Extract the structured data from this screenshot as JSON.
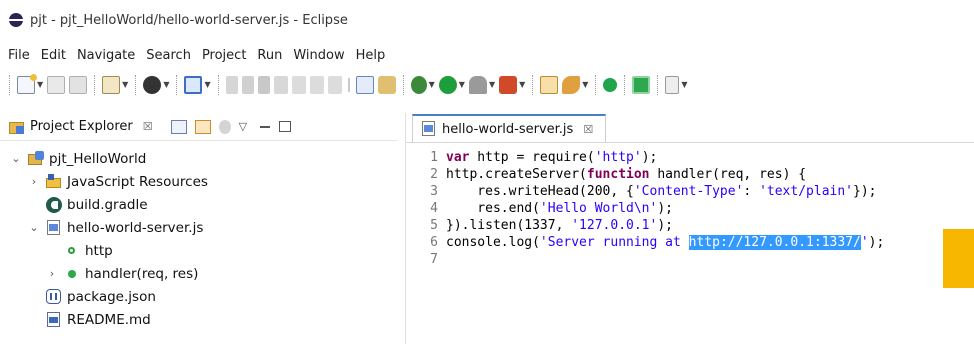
{
  "window": {
    "title": "pjt - pjt_HelloWorld/hello-world-server.js - Eclipse"
  },
  "menu": [
    "File",
    "Edit",
    "Navigate",
    "Search",
    "Project",
    "Run",
    "Window",
    "Help"
  ],
  "toolbar": {
    "icons": [
      "new-wizard-icon",
      "save-icon",
      "save-all-icon",
      "new-package-icon",
      "debug-icon",
      "open-perspective-icon",
      "skip-breakpoints-icon",
      "suspend-icon",
      "terminate-icon",
      "disconnect-icon",
      "step-into-icon",
      "step-over-icon",
      "step-return-icon",
      "format-icon",
      "run-last-icon",
      "run-icon",
      "coverage-icon",
      "external-tools-icon",
      "open-type-icon",
      "search-icon",
      "pin-icon",
      "next-annotation-icon"
    ]
  },
  "project_explorer": {
    "tab_label": "Project Explorer",
    "close_glyph": "☒",
    "tree": [
      {
        "label": "pjt_HelloWorld",
        "depth": 0,
        "twisty": "expanded",
        "icon": "project-icon"
      },
      {
        "label": "JavaScript Resources",
        "depth": 1,
        "twisty": "collapsed",
        "icon": "js-resources-icon"
      },
      {
        "label": "build.gradle",
        "depth": 1,
        "twisty": "none",
        "icon": "gradle-icon"
      },
      {
        "label": "hello-world-server.js",
        "depth": 1,
        "twisty": "expanded",
        "icon": "js-file-icon",
        "selected": true
      },
      {
        "label": "http",
        "depth": 2,
        "twisty": "none",
        "icon": "variable-icon"
      },
      {
        "label": "handler(req, res)",
        "depth": 2,
        "twisty": "collapsed",
        "icon": "function-icon"
      },
      {
        "label": "package.json",
        "depth": 1,
        "twisty": "none",
        "icon": "json-file-icon"
      },
      {
        "label": "README.md",
        "depth": 1,
        "twisty": "none",
        "icon": "md-file-icon"
      }
    ]
  },
  "editor": {
    "tab_label": "hello-world-server.js",
    "close_glyph": "☒",
    "lines": [
      {
        "n": "1",
        "parts": [
          {
            "t": "var",
            "c": "kw"
          },
          {
            "t": " http = require(",
            "c": ""
          },
          {
            "t": "'http'",
            "c": "str"
          },
          {
            "t": ");",
            "c": ""
          }
        ]
      },
      {
        "n": "2",
        "parts": [
          {
            "t": "http.createServer(",
            "c": ""
          },
          {
            "t": "function",
            "c": "kw"
          },
          {
            "t": " handler(req, res) {",
            "c": ""
          }
        ]
      },
      {
        "n": "3",
        "parts": [
          {
            "t": "    res.writeHead(200, {",
            "c": ""
          },
          {
            "t": "'Content-Type'",
            "c": "str"
          },
          {
            "t": ": ",
            "c": ""
          },
          {
            "t": "'text/plain'",
            "c": "str"
          },
          {
            "t": "});",
            "c": ""
          }
        ]
      },
      {
        "n": "4",
        "parts": [
          {
            "t": "    res.end(",
            "c": ""
          },
          {
            "t": "'Hello World\\n'",
            "c": "str"
          },
          {
            "t": ");",
            "c": ""
          }
        ]
      },
      {
        "n": "5",
        "parts": [
          {
            "t": "}).listen(1337, ",
            "c": ""
          },
          {
            "t": "'127.0.0.1'",
            "c": "str"
          },
          {
            "t": ");",
            "c": ""
          }
        ]
      },
      {
        "n": "6",
        "parts": [
          {
            "t": "console.log(",
            "c": ""
          },
          {
            "t": "'Server running at ",
            "c": "str"
          },
          {
            "t": "http://127.0.0.1:1337/",
            "c": "str sel"
          },
          {
            "t": "'",
            "c": "str"
          },
          {
            "t": ");",
            "c": ""
          }
        ]
      },
      {
        "n": "7",
        "parts": []
      }
    ]
  }
}
